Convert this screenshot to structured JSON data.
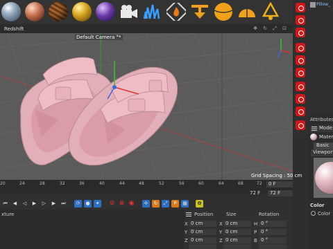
{
  "viewport": {
    "title": "Redshift",
    "controls": "✥ ↻ ⤢ ⊡",
    "camera_label": "Default Camera °*",
    "grid_spacing": "Grid Spacing : 50 cm"
  },
  "top_toolbar": {
    "icons": [
      "sphere-icon",
      "sphere-icon",
      "sphere-icon",
      "sphere-icon",
      "sphere-icon",
      "camera-icon",
      "grass-icon",
      "fire-icon",
      "arrow-icon",
      "ball-icon",
      "dome-icon",
      "light-icon"
    ]
  },
  "object_manager": {
    "object_name": "Pillow_"
  },
  "attributes": {
    "title": "Attributes",
    "mode_label": "Mode",
    "material_label": "Materia",
    "tab_basic": "Basic",
    "tab_viewport": "Viewport",
    "color_title": "Color",
    "color_row_label": "Color"
  },
  "timeline": {
    "ticks": [
      "20",
      "24",
      "28",
      "32",
      "36",
      "40",
      "44",
      "48",
      "52",
      "56",
      "60",
      "64",
      "68",
      "72"
    ],
    "current_frame": "0 F",
    "end_frame_left": "72 F",
    "end_frame_right": "72 F"
  },
  "material_manager": {
    "label": "xture"
  },
  "coordinates": {
    "position_header": "Position",
    "size_header": "Size",
    "rotation_header": "Rotation",
    "rows": [
      {
        "axis": "X",
        "pos": "0 cm",
        "size_axis": "X",
        "size": "0 cm",
        "rot_axis": "H",
        "rot": "0 °"
      },
      {
        "axis": "Y",
        "pos": "0 cm",
        "size_axis": "Y",
        "size": "0 cm",
        "rot_axis": "P",
        "rot": "0 °"
      },
      {
        "axis": "Z",
        "pos": "0 cm",
        "size_axis": "Z",
        "size": "0 cm",
        "rot_axis": "B",
        "rot": "0 °"
      }
    ]
  },
  "colors": {
    "viewport_bg": "#5b5b5b",
    "sandal": "#e2aeb8",
    "accent_red": "#d01818",
    "accent_blue": "#2d6fc0"
  }
}
